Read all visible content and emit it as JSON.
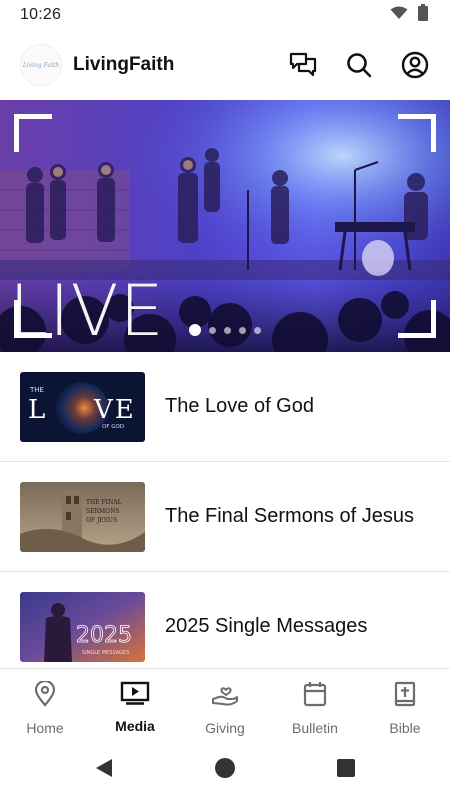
{
  "status_bar": {
    "time": "10:26",
    "icons": [
      "wifi-icon",
      "battery-icon"
    ]
  },
  "app_bar": {
    "logo_text": "Living Faith",
    "title": "LivingFaith",
    "actions": [
      "chat-icon",
      "search-icon",
      "account-icon"
    ]
  },
  "hero": {
    "overlay_text": "LIVE",
    "slide_count": 5,
    "active_slide": 1
  },
  "media": {
    "items": [
      {
        "title": "The Love of God",
        "thumb_text": "THE LOVE OF GOD"
      },
      {
        "title": "The Final Sermons of Jesus",
        "thumb_text": "THE FINAL SERMONS OF JESUS"
      },
      {
        "title": "2025 Single Messages",
        "thumb_text": "2025 SINGLE MESSAGES"
      }
    ]
  },
  "bottom_nav": {
    "items": [
      {
        "label": "Home",
        "icon": "location-pin-icon",
        "active": false
      },
      {
        "label": "Media",
        "icon": "video-icon",
        "active": true
      },
      {
        "label": "Giving",
        "icon": "giving-hand-icon",
        "active": false
      },
      {
        "label": "Bulletin",
        "icon": "calendar-icon",
        "active": false
      },
      {
        "label": "Bible",
        "icon": "bible-icon",
        "active": false
      }
    ]
  },
  "colors": {
    "hero_gradient": [
      "#6a3fa8",
      "#4d41c9",
      "#5a54e6"
    ],
    "active_nav": "#111111",
    "inactive_nav": "#6d6d6d",
    "divider": "#e4e4e4"
  }
}
